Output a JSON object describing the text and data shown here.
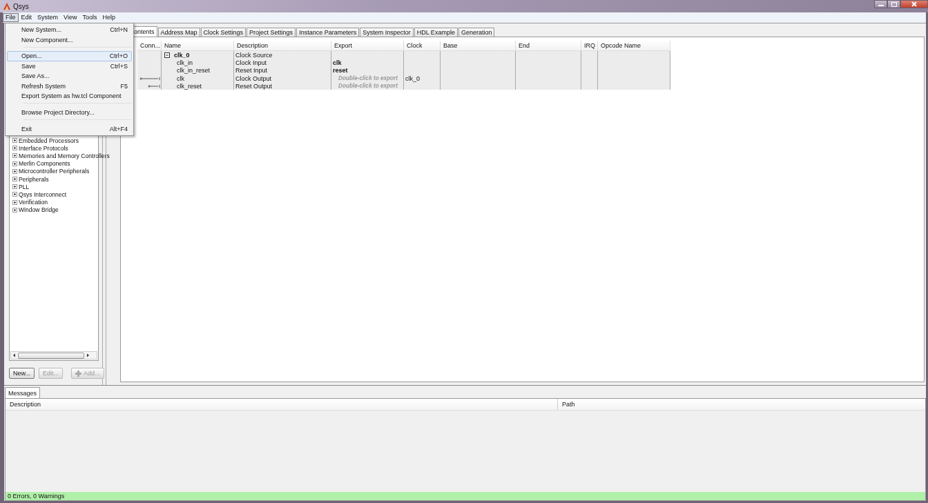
{
  "window": {
    "title": "Qsys"
  },
  "menubar": [
    {
      "label": "File",
      "selected": true
    },
    {
      "label": "Edit",
      "selected": false
    },
    {
      "label": "System",
      "selected": false
    },
    {
      "label": "View",
      "selected": false
    },
    {
      "label": "Tools",
      "selected": false
    },
    {
      "label": "Help",
      "selected": false
    }
  ],
  "file_menu": [
    {
      "label": "New System...",
      "shortcut": "Ctrl+N",
      "selected": false
    },
    {
      "label": "New Component...",
      "selected": false
    },
    {
      "kind": "separator"
    },
    {
      "label": "Open...",
      "shortcut": "Ctrl+O",
      "selected": true
    },
    {
      "label": "Save",
      "shortcut": "Ctrl+S",
      "selected": false
    },
    {
      "label": "Save As...",
      "selected": false
    },
    {
      "label": "Refresh System",
      "shortcut": "F5",
      "selected": false
    },
    {
      "label": "Export System as hw.tcl Component",
      "selected": false
    },
    {
      "kind": "separator"
    },
    {
      "label": "Browse Project Directory...",
      "selected": false
    },
    {
      "kind": "separator"
    },
    {
      "label": "Exit",
      "shortcut": "Alt+F4",
      "selected": false
    }
  ],
  "library_tree": [
    {
      "label": "Embedded Processors"
    },
    {
      "label": "Interface Protocols"
    },
    {
      "label": "Memories and Memory Controllers"
    },
    {
      "label": "Merlin Components"
    },
    {
      "label": "Microcontroller Peripherals"
    },
    {
      "label": "Peripherals"
    },
    {
      "label": "PLL"
    },
    {
      "label": "Qsys Interconnect"
    },
    {
      "label": "Verification"
    },
    {
      "label": "Window Bridge"
    }
  ],
  "library_buttons": [
    {
      "kind": "plain",
      "label": "New...",
      "disabled": false
    },
    {
      "kind": "plain",
      "label": "Edit...",
      "disabled": true
    },
    {
      "kind": "add",
      "label": "Add...",
      "disabled": true
    }
  ],
  "tabs": [
    {
      "label": "ontents",
      "selected": true
    },
    {
      "label": "Address Map",
      "selected": false
    },
    {
      "label": "Clock Settings",
      "selected": false
    },
    {
      "label": "Project Settings",
      "selected": false
    },
    {
      "label": "Instance Parameters",
      "selected": false
    },
    {
      "label": "System Inspector",
      "selected": false
    },
    {
      "label": "HDL Example",
      "selected": false
    },
    {
      "label": "Generation",
      "selected": false
    }
  ],
  "table": {
    "columns": [
      "Conn...",
      "Name",
      "Description",
      "Export",
      "Clock",
      "Base",
      "End",
      "IRQ",
      "Opcode Name"
    ],
    "rows": [
      {
        "kind": "instance",
        "expanded": true,
        "connected": false,
        "name": "clk_0",
        "description": "Clock Source"
      },
      {
        "kind": "port",
        "connected": false,
        "name": "clk_in",
        "description": "Clock Input",
        "export": {
          "kind": "exported",
          "text": "clk"
        }
      },
      {
        "kind": "port",
        "connected": false,
        "name": "clk_in_reset",
        "description": "Reset Input",
        "export": {
          "kind": "exported",
          "text": "reset"
        }
      },
      {
        "kind": "port",
        "connected": true,
        "name": "clk",
        "description": "Clock Output",
        "export": {
          "kind": "hint",
          "text": "Double-click to export"
        },
        "clock": "clk_0"
      },
      {
        "kind": "port",
        "connected": true,
        "name": "clk_reset",
        "description": "Reset Output",
        "export": {
          "kind": "hint",
          "text": "Double-click to export"
        }
      }
    ]
  },
  "messages": {
    "tab": "Messages",
    "columns": [
      "Description",
      "Path"
    ],
    "status": "0 Errors, 0 Warnings"
  }
}
